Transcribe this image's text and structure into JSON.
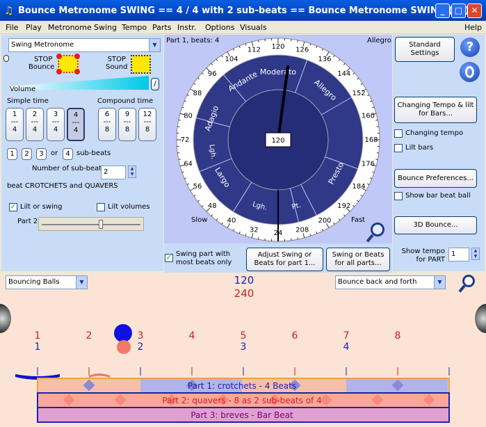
{
  "window": {
    "title": "Bounce Metronome SWING == 4 / 4 with 2 sub-beats == Bounce Metronome SWING  (F6)",
    "min": "_",
    "max": "□",
    "close": "✕"
  },
  "menu": [
    "File",
    "Play",
    "Metronome",
    "Swing",
    "Tempo",
    "Parts",
    "Instr.",
    "Options",
    "Visuals",
    "Help"
  ],
  "left": {
    "mode_select": "Swing Metronome",
    "stop_bounce": [
      "STOP",
      "Bounce"
    ],
    "stop_sound": [
      "STOP",
      "Sound"
    ],
    "volume_label": "Volume",
    "volume_btn": "/",
    "simple_time": "Simple time",
    "compound_time": "Compound time",
    "simple_sigs": [
      [
        "1",
        "4"
      ],
      [
        "2",
        "4"
      ],
      [
        "3",
        "4"
      ],
      [
        "4",
        "4"
      ]
    ],
    "compound_sigs": [
      [
        "6",
        "8"
      ],
      [
        "9",
        "8"
      ],
      [
        "12",
        "8"
      ]
    ],
    "dash": "---",
    "subbeat_buttons": [
      "1",
      "2",
      "3"
    ],
    "subbeat_or": "or",
    "subbeat_4": "4",
    "subbeats_label": "sub-beats",
    "num_subbeats_label": "Number of sub-beats",
    "num_subbeats_value": "2",
    "beat_label": "beat",
    "beat_value": "CROTCHETS and QUAVERS",
    "lilt_swing": "Lilt or swing",
    "lilt_volumes": "Lilt volumes",
    "part2_label": "Part 2",
    "lilt_swing_checked": true,
    "lilt_volumes_checked": false
  },
  "dial": {
    "part_label": "Part 1, beats: 4",
    "allegro_corner": "Allegro",
    "slow": "Slow",
    "fast": "Fast",
    "tempo_value": "120",
    "tempo_numbers": [
      "24",
      "32",
      "40",
      "48",
      "56",
      "64",
      "72",
      "80",
      "88",
      "96",
      "104",
      "112",
      "120",
      "126",
      "136",
      "144",
      "152",
      "160",
      "168",
      "176",
      "184",
      "192",
      "200",
      "208"
    ],
    "inner_labels": [
      "Moderato",
      "Allegro",
      "Presto",
      "Pt.",
      "Lgh.",
      "Largo",
      "Lgh.",
      "Adagio",
      "Andante"
    ],
    "swing_most": "Swing part with most beats only",
    "swing_most_checked": true,
    "adjust_btn": "Adjust Swing or Beats for part 1...",
    "swing_all_btn": "Swing or Beats for all parts..."
  },
  "right": {
    "standard": "Standard Settings",
    "help": "?",
    "changing_btn": "Changing Tempo & lilt for Bars...",
    "changing_tempo": "Changing tempo",
    "lilt_bars": "Lilt bars",
    "bounce_prefs": "Bounce Preferences...",
    "show_bar_ball": "Show bar beat ball",
    "bounce3d": "3D Bounce...",
    "show_tempo_label": "Show tempo for PART",
    "show_tempo_value": "1"
  },
  "bottom": {
    "left_select": "Bouncing Balls",
    "right_select": "Bounce back and forth",
    "tempo1": "120",
    "tempo2": "240",
    "top_nums": [
      "1",
      "2",
      "3",
      "4",
      "5",
      "6",
      "7",
      "8"
    ],
    "bot_nums": [
      "1",
      "2",
      "3",
      "4"
    ],
    "part1": "Part 1: crotchets - 4 Beats",
    "part2": "Part 2: quavers - 8 as 2 sub-beats of 4",
    "part3": "Part 3: breves - Bar Beat"
  },
  "colors": {
    "dial_outer": "#ffffff",
    "dial_ring": "#303888",
    "dial_inner": "#252c78",
    "panel": "#c8dcf8",
    "title": "#0446c8",
    "part1": "#2020b0",
    "part2": "#d02020",
    "part3": "#800080"
  }
}
